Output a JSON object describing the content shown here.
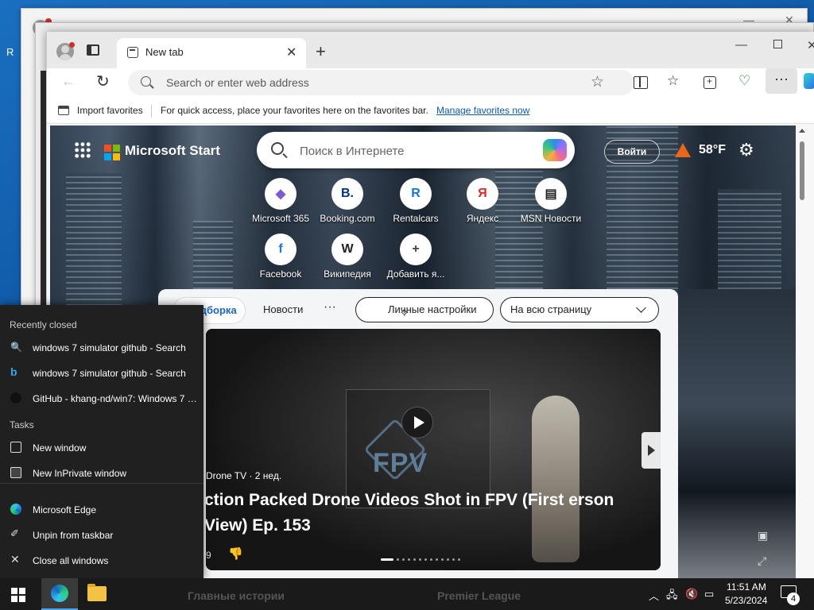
{
  "desktop": {
    "edge_letter": "R"
  },
  "browser": {
    "tab_title": "New tab",
    "new_tab_symbol": "+",
    "address_placeholder": "Search or enter web address",
    "favbar": {
      "import_label": "Import favorites",
      "hint": "For quick access, place your favorites here on the favorites bar.",
      "manage_link": "Manage favorites now"
    }
  },
  "msn": {
    "brand": "Microsoft Start",
    "search_placeholder": "Поиск в Интернете",
    "signin": "Войти",
    "weather": "58°F",
    "tiles": [
      {
        "label": "Microsoft 365",
        "glyph": "◆",
        "color": "#7c5ad8"
      },
      {
        "label": "Booking.com",
        "glyph": "B.",
        "color": "#003580"
      },
      {
        "label": "Rentalcars",
        "glyph": "R",
        "color": "#0e77d9"
      },
      {
        "label": "Яндекс",
        "glyph": "Я",
        "color": "#e02a2a"
      },
      {
        "label": "MSN Новости",
        "glyph": "▤",
        "color": "#222222"
      },
      {
        "label": "Facebook",
        "glyph": "f",
        "color": "#1877f2"
      },
      {
        "label": "Википедия",
        "glyph": "W",
        "color": "#222222"
      },
      {
        "label": "Добавить я...",
        "glyph": "+",
        "color": "#444444"
      }
    ],
    "feed": {
      "selected_tab": "одборка",
      "news_tab": "Новости",
      "more": "···",
      "personalize": "Личные настройки",
      "layout": "На всю страницу"
    },
    "video": {
      "source": "Drone TV · 2 нед.",
      "title": "ction Packed Drone Videos Shot in FPV (First erson View) Ep. 153",
      "likes": "9",
      "fpv_label": "FPV"
    }
  },
  "jumplist": {
    "recently_closed_heading": "Recently closed",
    "recent": [
      "windows 7 simulator github - Search",
      "windows 7 simulator github - Search",
      "GitHub - khang-nd/win7: Windows 7 S..."
    ],
    "tasks_heading": "Tasks",
    "tasks": [
      "New window",
      "New InPrivate window"
    ],
    "app_actions": [
      "Microsoft Edge",
      "Unpin from taskbar",
      "Close all windows"
    ]
  },
  "taskbar": {
    "news_ticker_1": "Главные истории",
    "news_ticker_2": "Premier League",
    "time": "11:51 AM",
    "date": "5/23/2024",
    "notification_count": "4"
  }
}
